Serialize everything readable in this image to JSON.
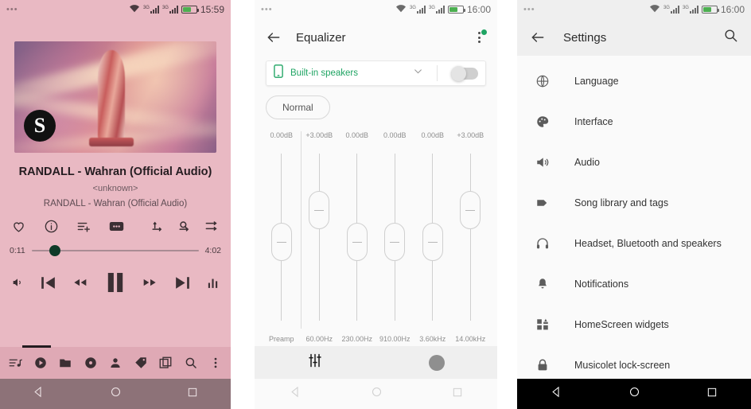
{
  "player": {
    "status": {
      "dots": "•••",
      "time": "15:59",
      "network": "3G",
      "network2": "3G"
    },
    "album_art": {
      "logo_letter": "S",
      "description": "statue-artwork"
    },
    "title": "RANDALL - Wahran (Official Audio)",
    "artist": "<unknown>",
    "album": "RANDALL - Wahran (Official Audio)",
    "actions": [
      {
        "name": "favorite-icon",
        "glyph": "heart"
      },
      {
        "name": "info-icon",
        "glyph": "info"
      },
      {
        "name": "add-to-playlist-icon",
        "glyph": "playlist-add"
      },
      {
        "name": "more-options-icon",
        "glyph": "more"
      }
    ],
    "right_actions": [
      {
        "name": "repeat-one-icon",
        "label": "1"
      },
      {
        "name": "repeat-queue-icon",
        "label": "Q"
      },
      {
        "name": "shuffle-icon",
        "label": "shuffle"
      }
    ],
    "elapsed": "0:11",
    "duration": "4:02",
    "progress_percent": 14,
    "transport": [
      {
        "name": "volume-icon"
      },
      {
        "name": "previous-track-button"
      },
      {
        "name": "rewind-button"
      },
      {
        "name": "pause-button"
      },
      {
        "name": "fast-forward-button"
      },
      {
        "name": "next-track-button"
      },
      {
        "name": "equalizer-icon"
      }
    ],
    "tabs": [
      {
        "name": "tab-queue",
        "selected": true
      },
      {
        "name": "tab-now-playing",
        "selected": false
      },
      {
        "name": "tab-folders",
        "selected": false
      },
      {
        "name": "tab-albums",
        "selected": false
      },
      {
        "name": "tab-artists",
        "selected": false
      },
      {
        "name": "tab-genres",
        "selected": false
      },
      {
        "name": "tab-playlists",
        "selected": false
      },
      {
        "name": "tab-search",
        "selected": false
      },
      {
        "name": "tab-overflow",
        "selected": false
      }
    ]
  },
  "equalizer": {
    "status": {
      "dots": "•••",
      "time": "16:00"
    },
    "title": "Equalizer",
    "back_label": "back",
    "overflow_has_badge": true,
    "badge_color": "#1fa463",
    "device": {
      "name": "Built-in speakers",
      "icon": "phone-icon",
      "accent": "#1fa463",
      "toggle_on": false
    },
    "preset": "Normal",
    "bands": [
      {
        "label": "Preamp",
        "db": "0.00dB",
        "position": 50
      },
      {
        "label": "60.00Hz",
        "db": "+3.00dB",
        "position": 32
      },
      {
        "label": "230.00Hz",
        "db": "0.00dB",
        "position": 50
      },
      {
        "label": "910.00Hz",
        "db": "0.00dB",
        "position": 50
      },
      {
        "label": "3.60kHz",
        "db": "0.00dB",
        "position": 50
      },
      {
        "label": "14.00kHz",
        "db": "+3.00dB",
        "position": 32
      }
    ],
    "actions": [
      {
        "name": "equalizer-sliders-button"
      },
      {
        "name": "bass-boost-knob-button"
      }
    ]
  },
  "settings": {
    "status": {
      "dots": "•••",
      "time": "16:00"
    },
    "title": "Settings",
    "search_label": "search",
    "items": [
      {
        "label": "Language",
        "icon": "globe-icon"
      },
      {
        "label": "Interface",
        "icon": "palette-icon"
      },
      {
        "label": "Audio",
        "icon": "speaker-icon"
      },
      {
        "label": "Song library and tags",
        "icon": "tag-icon"
      },
      {
        "label": "Headset, Bluetooth and speakers",
        "icon": "headphones-icon"
      },
      {
        "label": "Notifications",
        "icon": "bell-icon"
      },
      {
        "label": "HomeScreen widgets",
        "icon": "widgets-icon"
      },
      {
        "label": "Musicolet lock-screen",
        "icon": "lock-icon"
      }
    ]
  },
  "navbar": {
    "back": "back-triangle-icon",
    "home": "home-circle-icon",
    "recents": "recents-square-icon"
  }
}
